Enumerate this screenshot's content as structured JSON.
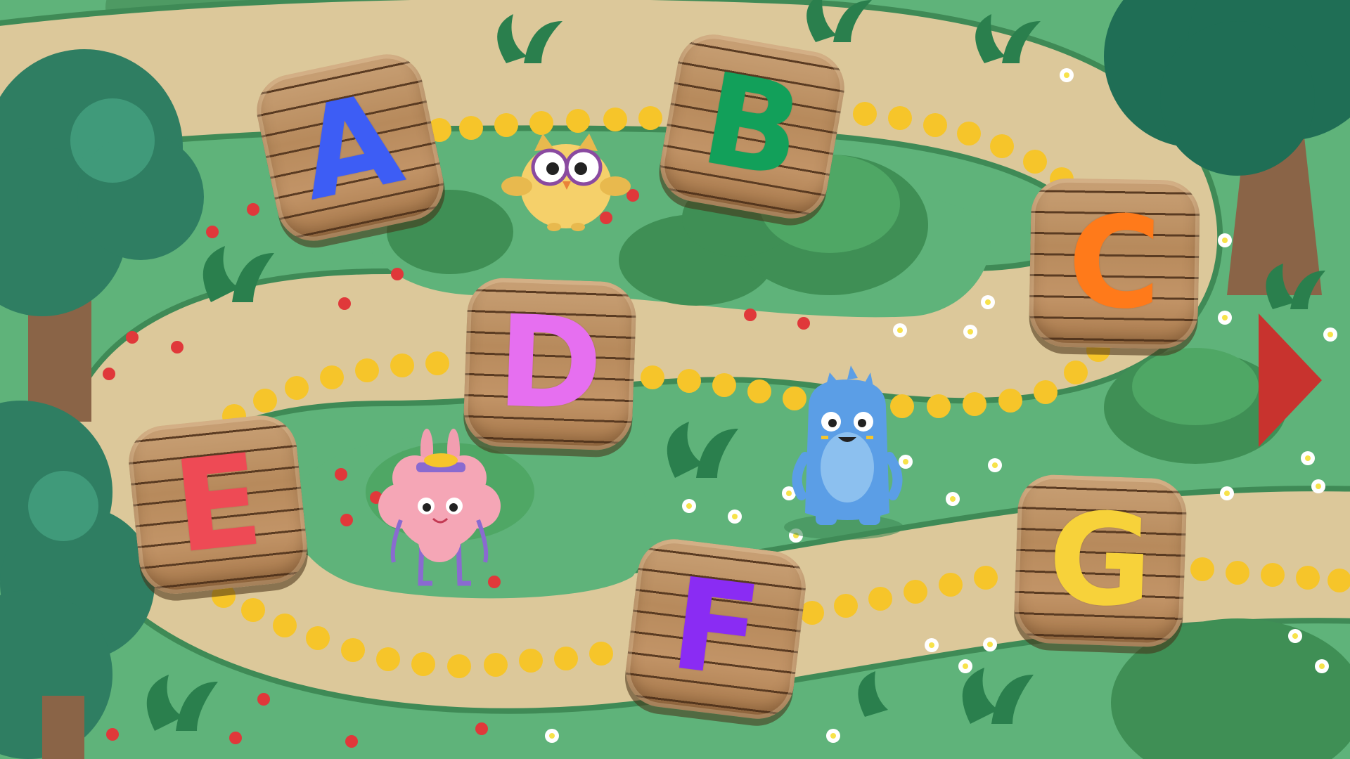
{
  "letters": {
    "a": {
      "label": "A",
      "color": "#3d5df5"
    },
    "b": {
      "label": "B",
      "color": "#12a05a"
    },
    "c": {
      "label": "C",
      "color": "#ff7a1a"
    },
    "d": {
      "label": "D",
      "color": "#e66ff0"
    },
    "e": {
      "label": "E",
      "color": "#ee4a55"
    },
    "f": {
      "label": "F",
      "color": "#8a2cf3"
    },
    "g": {
      "label": "G",
      "color": "#f7d23a"
    }
  },
  "colors": {
    "grass": "#5fb37a",
    "path": "#dcc89a",
    "dots": "#f6c52a",
    "next_arrow": "#c8332e"
  },
  "characters": [
    "owl",
    "blue-monster",
    "pink-bunny"
  ],
  "icons": {
    "next": "play-triangle-icon"
  }
}
